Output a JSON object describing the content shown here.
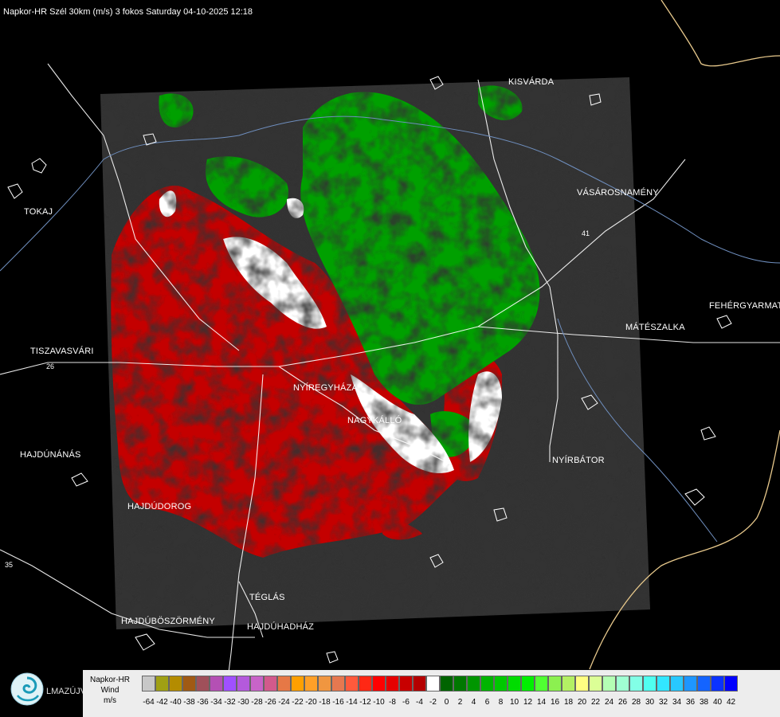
{
  "header": {
    "title": "Napkor-HR Szél 30km (m/s) 3 fokos Saturday 04-10-2025 12:18"
  },
  "cities": [
    {
      "name": "KISVÁRDA"
    },
    {
      "name": "TOKAJ"
    },
    {
      "name": "VÁSÁROSNAMÉNY"
    },
    {
      "name": "FEHÉRGYARMAT"
    },
    {
      "name": "MÁTÉSZALKA"
    },
    {
      "name": "TISZAVASVÁRI"
    },
    {
      "name": "NYÍREGYHÁZA"
    },
    {
      "name": "NAGYKÁLLÓ"
    },
    {
      "name": "NYÍRBÁTOR"
    },
    {
      "name": "HAJDÚNÁNÁS"
    },
    {
      "name": "HAJDÚDOROG"
    },
    {
      "name": "TÉGLÁS"
    },
    {
      "name": "HAJDÚBÖSZÖRMÉNY"
    },
    {
      "name": "HAJDÚHADHÁZ"
    }
  ],
  "road_numbers": [
    "26",
    "41",
    "35"
  ],
  "logo": {
    "text": "LMAZÚJVÁR",
    "icon": "swirl-logo-icon"
  },
  "legend": {
    "title_lines": [
      "Napkor-HR",
      "Wind",
      "m/s"
    ],
    "values": [
      "-64",
      "-42",
      "-40",
      "-38",
      "-36",
      "-34",
      "-32",
      "-30",
      "-28",
      "-26",
      "-24",
      "-22",
      "-20",
      "-18",
      "-16",
      "-14",
      "-12",
      "-10",
      "-8",
      "-6",
      "-4",
      "-2",
      "0",
      "2",
      "4",
      "6",
      "8",
      "10",
      "12",
      "14",
      "16",
      "18",
      "20",
      "22",
      "24",
      "26",
      "28",
      "30",
      "32",
      "34",
      "36",
      "38",
      "40",
      "42"
    ],
    "colors": [
      "#c8c8c8",
      "#a0a014",
      "#b48c00",
      "#a05a14",
      "#a0505a",
      "#b450b4",
      "#a050ff",
      "#b45adc",
      "#c864c8",
      "#d25a8c",
      "#e67846",
      "#ffa000",
      "#ffa028",
      "#f09640",
      "#e67850",
      "#ff5a3c",
      "#ff2814",
      "#ff0000",
      "#e60000",
      "#c80000",
      "#b40000",
      "#ffffff",
      "#006400",
      "#007800",
      "#009600",
      "#00b400",
      "#00c800",
      "#00dc00",
      "#00f000",
      "#50ff32",
      "#8cf050",
      "#b4f064",
      "#ffff82",
      "#dcff96",
      "#b4ffb4",
      "#a0ffd2",
      "#82ffe6",
      "#50fff0",
      "#32e6ff",
      "#28c8ff",
      "#1e96ff",
      "#1464ff",
      "#0a32ff",
      "#0000ff"
    ]
  }
}
